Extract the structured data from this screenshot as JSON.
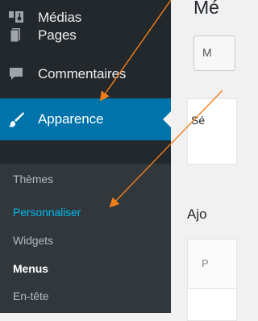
{
  "sidebar": {
    "items": [
      {
        "label": "Médias",
        "icon": "media-icon"
      },
      {
        "label": "Pages",
        "icon": "pages-icon"
      },
      {
        "label": "Commentaires",
        "icon": "comments-icon"
      },
      {
        "label": "Apparence",
        "icon": "appearance-icon",
        "current": true
      }
    ],
    "submenu": [
      {
        "label": "Thèmes"
      },
      {
        "label": "Personnaliser",
        "highlighted": true
      },
      {
        "label": "Widgets"
      },
      {
        "label": "Menus",
        "current": true
      },
      {
        "label": "En-tête"
      }
    ]
  },
  "content": {
    "title": "Mé",
    "tab_label": "M",
    "select_label": "Sé",
    "section_heading": "Ajo",
    "box_header_label": "P"
  },
  "colors": {
    "sidebar_bg": "#23282d",
    "submenu_bg": "#32373c",
    "current_bg": "#0073aa",
    "link_active": "#00b9eb",
    "annotation_arrow": "#f07f1a"
  }
}
